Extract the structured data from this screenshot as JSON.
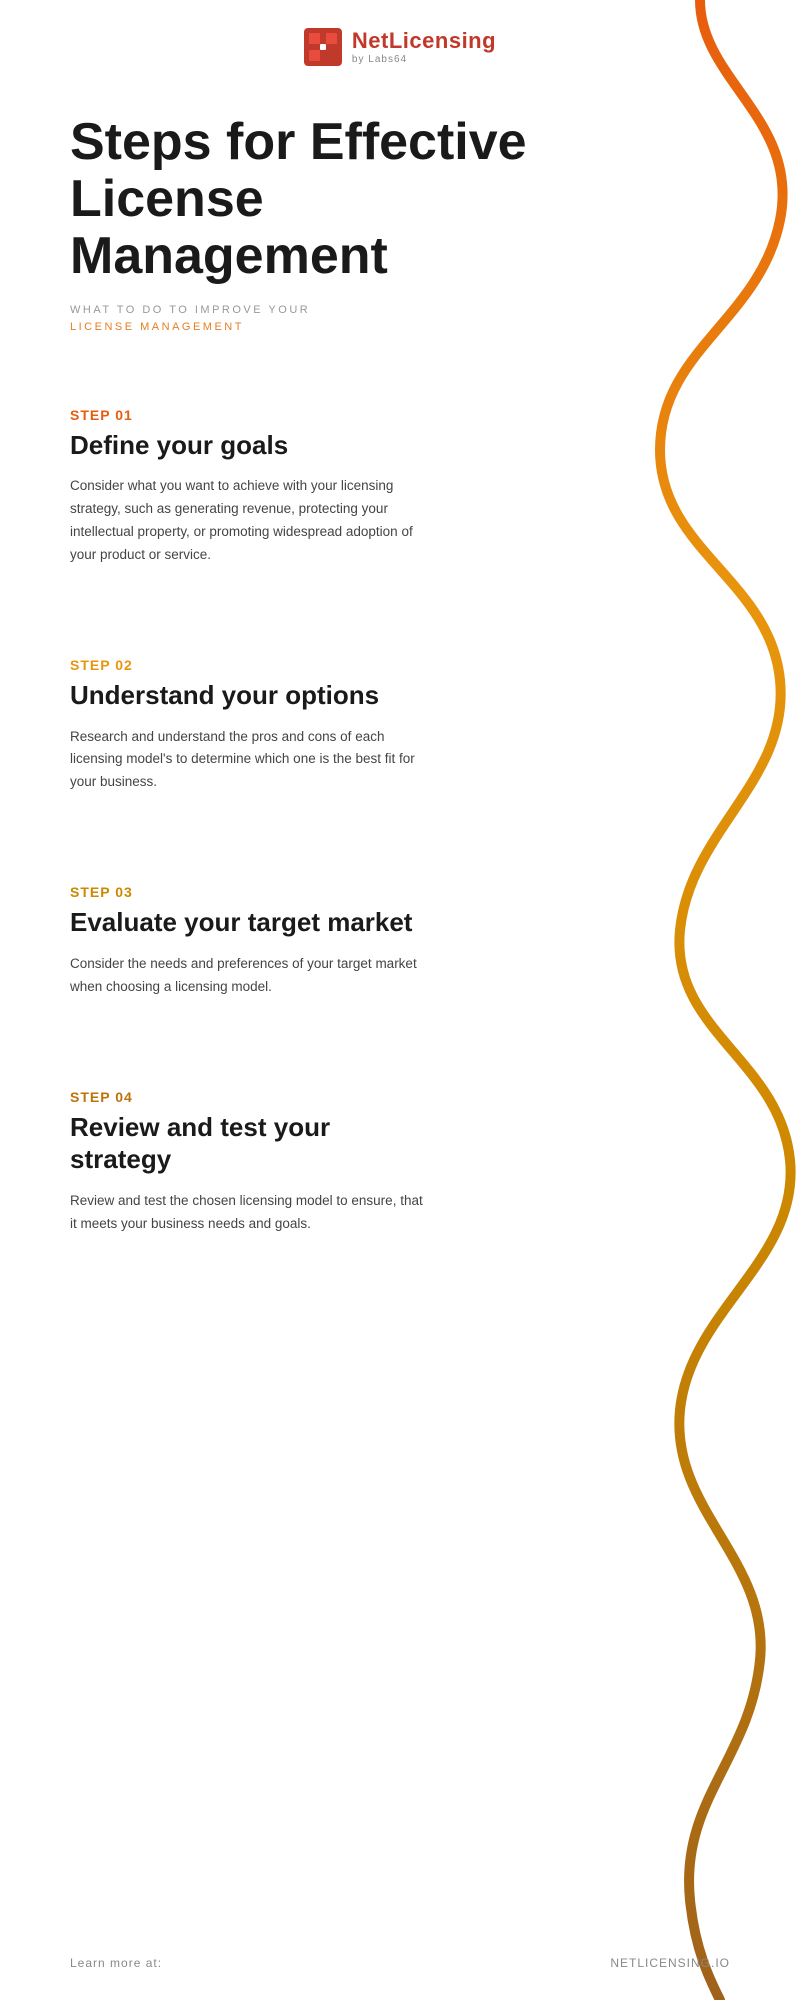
{
  "header": {
    "logo_name": "NetLicensing",
    "logo_sub": "by Labs64"
  },
  "title": {
    "line1": "Steps for Effective",
    "line2": "License Management",
    "subtitle_line1": "WHAT TO DO TO IMPROVE YOUR",
    "subtitle_line2": "LICENSE MANAGEMENT"
  },
  "steps": [
    {
      "id": "01",
      "label": "STEP 01",
      "color": "#e85c0d",
      "title": "Define your goals",
      "description": "Consider what you want to achieve with your licensing strategy, such as generating revenue, protecting your intellectual property, or promoting widespread adoption of your product or service."
    },
    {
      "id": "02",
      "label": "STEP 02",
      "color": "#e8950d",
      "title": "Understand your options",
      "description": "Research and understand the pros and cons of each licensing model's to determine which one is the best fit for your business."
    },
    {
      "id": "03",
      "label": "STEP 03",
      "color": "#cc8800",
      "title": "Evaluate your target market",
      "description": "Consider the needs and preferences of your target market when choosing a licensing model."
    },
    {
      "id": "04",
      "label": "STEP 04",
      "color": "#c0720a",
      "title": "Review and test your strategy",
      "description": "Review and test the chosen licensing model to ensure, that it meets your business needs and goals."
    }
  ],
  "footer": {
    "left": "Learn more at:",
    "right": "NETLICENSING.IO"
  },
  "wavy_path": {
    "colors": {
      "start": "#e85c0d",
      "mid1": "#e8950d",
      "mid2": "#cc8800",
      "end": "#c0720a"
    }
  }
}
